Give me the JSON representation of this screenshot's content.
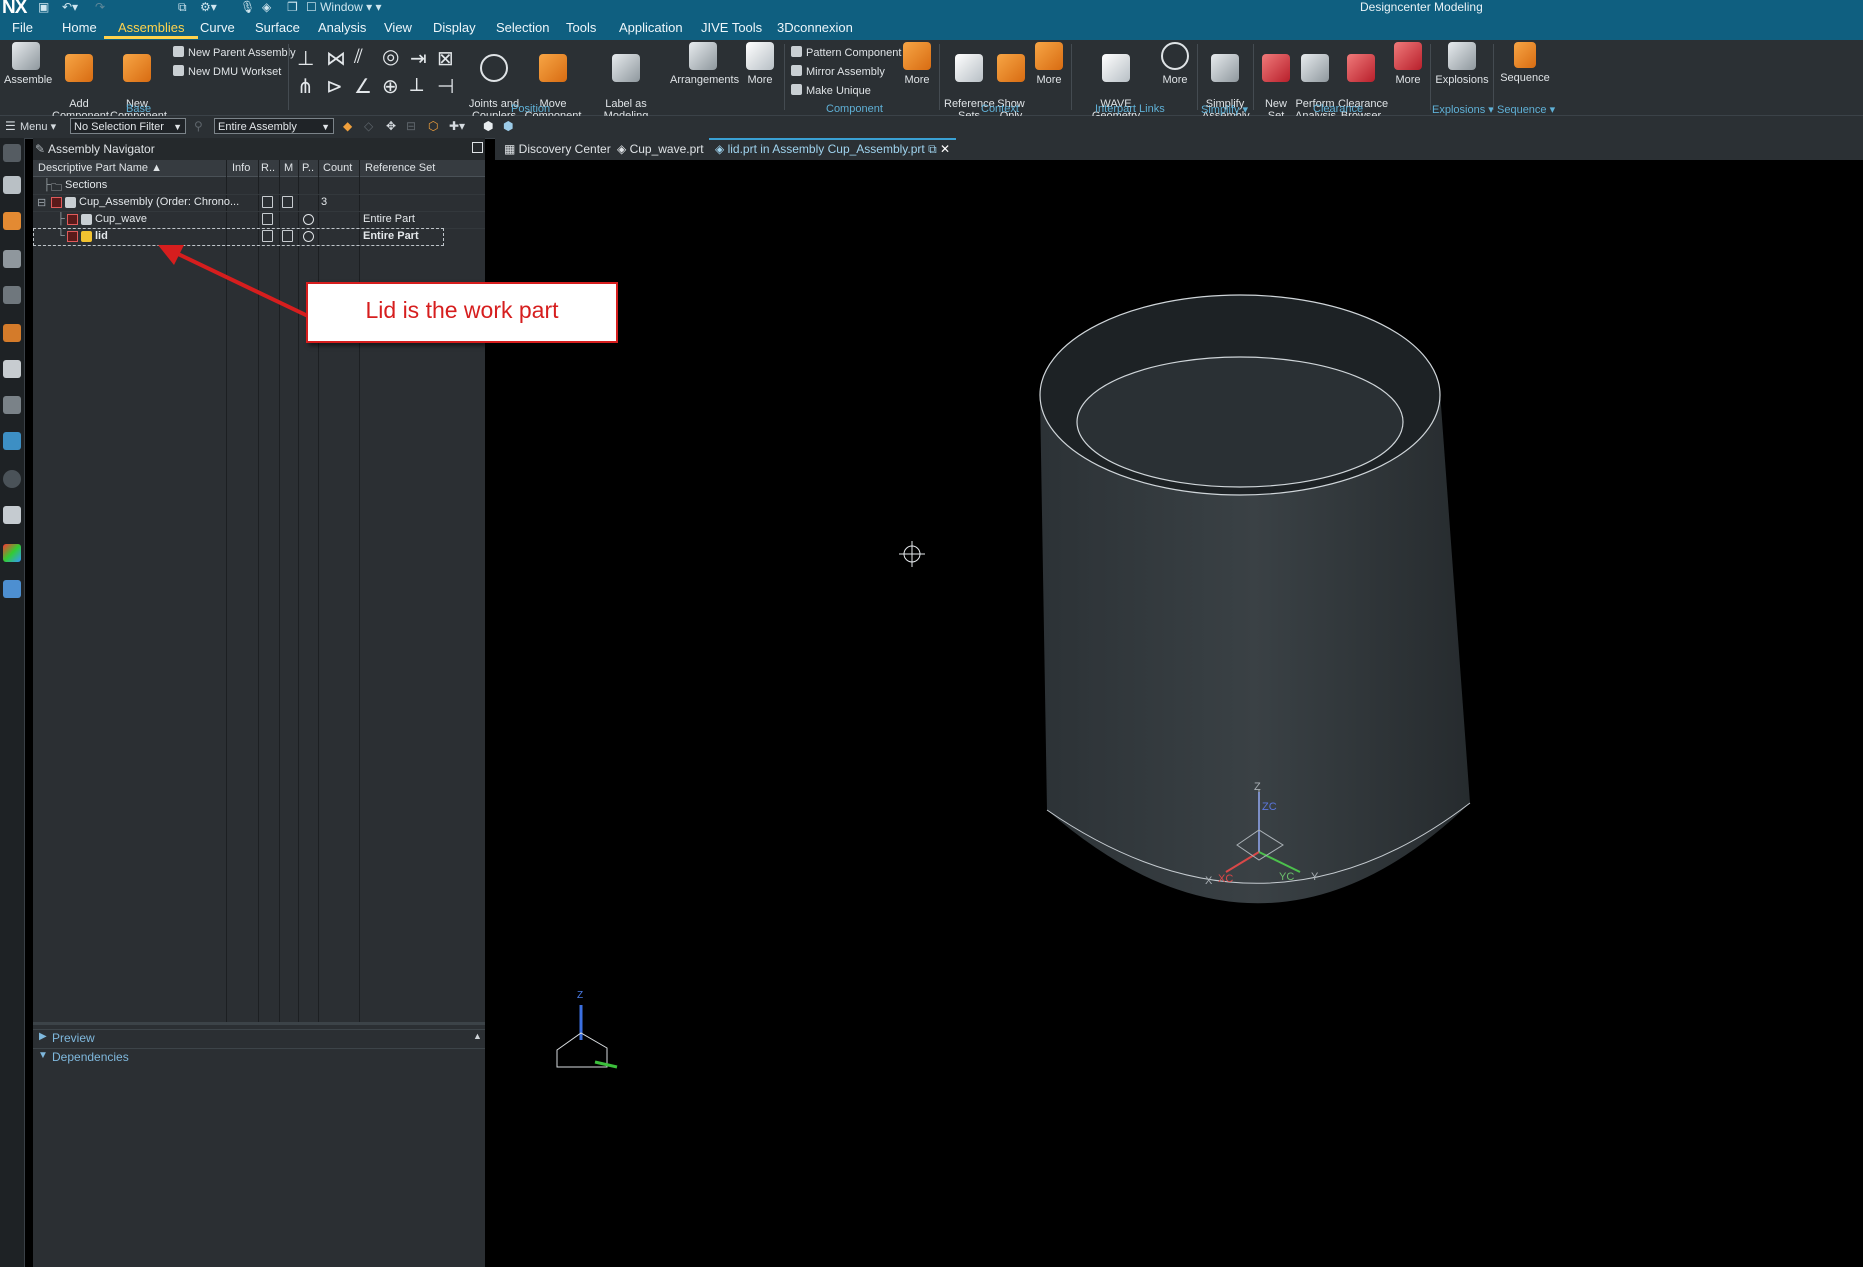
{
  "app": {
    "logo": "NX",
    "window_menu": "Window",
    "title": "Designcenter Modeling"
  },
  "menubar": {
    "items": [
      "File",
      "Home",
      "Assemblies",
      "Curve",
      "Surface",
      "Analysis",
      "View",
      "Display",
      "Selection",
      "Tools",
      "Application",
      "JIVE Tools",
      "3Dconnexion"
    ],
    "active": "Assemblies"
  },
  "ribbon": {
    "assemble": "Assemble",
    "add_component": "Add\nComponent",
    "new_component": "New\nComponent",
    "new_parent_assembly": "New Parent Assembly",
    "new_dmu_workset": "New DMU Workset",
    "group_base": "Base",
    "joints_couplers": "Joints and\nCouplers ▾",
    "move_component": "Move\nComponent",
    "label_as_modeling": "Label as Modeling\nComponent",
    "arrangements": "Arrangements",
    "more1": "More",
    "group_position": "Position",
    "pattern_component": "Pattern Component",
    "mirror_assembly": "Mirror Assembly",
    "make_unique": "Make Unique",
    "more2": "More",
    "group_component": "Component",
    "reference_sets": "Reference\nSets",
    "show_only": "Show\nOnly",
    "more3": "More",
    "group_context": "Context",
    "wave_linker": "WAVE Geometry\nLinker",
    "more4": "More",
    "group_interpart": "Interpart Links",
    "simplify_assembly": "Simplify\nAssembly",
    "group_simplify": "Simplify ▾",
    "new_set": "New\nSet",
    "perform_analysis": "Perform\nAnalysis",
    "clearance_browser": "Clearance\nBrowser",
    "more5": "More",
    "group_clearance": "Clearance",
    "explosions": "Explosions",
    "group_explosions": "Explosions ▾",
    "sequence": "Sequence",
    "group_sequence": "Sequence ▾"
  },
  "toolbar2": {
    "menu": "Menu ▾",
    "selection_filter": "No Selection Filter",
    "scope": "Entire Assembly"
  },
  "navigator": {
    "title": "Assembly Navigator",
    "columns": [
      "Descriptive Part Name ▲",
      "Info",
      "R..",
      "M",
      "P..",
      "Count",
      "Reference Set"
    ],
    "rows": [
      {
        "name": "Sections",
        "count": "",
        "refset": ""
      },
      {
        "name": "Cup_Assembly (Order: Chrono...",
        "count": "3",
        "refset": ""
      },
      {
        "name": "Cup_wave",
        "count": "",
        "refset": "Entire Part"
      },
      {
        "name": "lid",
        "count": "",
        "refset": "Entire Part"
      }
    ],
    "preview": "Preview",
    "dependencies": "Dependencies"
  },
  "tabs": [
    "Discovery Center",
    "Cup_wave.prt",
    "lid.prt in Assembly Cup_Assembly.prt"
  ],
  "triad": {
    "z": "Z",
    "zc": "ZC",
    "x": "X",
    "xc": "XC",
    "yc": "YC",
    "y": "Y",
    "mini_z": "Z"
  },
  "annotation": {
    "text": "Lid is the work part"
  },
  "colors": {
    "titlebar": "#0f5f80",
    "accent": "#3aa1d4",
    "annotation": "#d61e1e",
    "ribbon": "#2b3034"
  }
}
